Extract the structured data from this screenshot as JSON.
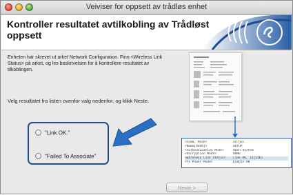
{
  "window": {
    "title": "Veiviser for oppsett av trådløs enhet"
  },
  "header": {
    "title": "Kontroller resultatet avtilkobling av Trådløst oppsett"
  },
  "content": {
    "description": "Enheten har skrevet ut arket Network Configuration. Finn <Wireless Link Status> på arket, og les beskrivelsen for å kontrollere resultatet av tilkoblingen.",
    "instruction": "Velg resultatet fra listen ovenfor valg nedenfor, og klikk Neste."
  },
  "options": [
    {
      "label": "\"Link OK.\"",
      "selected": false
    },
    {
      "label": "\"Failed To Associate\"",
      "selected": false
    }
  ],
  "zoom_panel": {
    "rows": [
      {
        "key": "<Comm. Mode>",
        "value": "Ad-hoc"
      },
      {
        "key": "<Name(SSID)>",
        "value": "SETUP"
      },
      {
        "key": "<Authentication Mode>",
        "value": "Open System"
      },
      {
        "key": "<Encryption Mode>",
        "value": "NONE"
      },
      {
        "key": "<Wireless Link Status>",
        "value": "Link OK, 11(11b)"
      },
      {
        "key": "<Tx Power Mode>",
        "value": "Enable ON"
      }
    ]
  },
  "buttons": {
    "next_label": "Neste >"
  },
  "colors": {
    "accent": "#1f4e8c",
    "arrow": "#2a6fc4"
  }
}
